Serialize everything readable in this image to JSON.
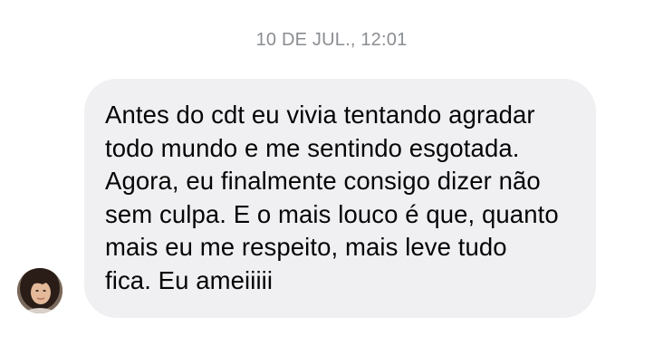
{
  "conversation": {
    "timestamp": "10 DE JUL., 12:01"
  },
  "message": {
    "text": "Antes do cdt eu vivia tentando agradar\ntodo mundo e me sentindo esgotada.\nAgora, eu finalmente consigo dizer não\nsem culpa. E o mais louco é que, quanto\nmais eu me respeito, mais leve tudo\nfica. Eu ameiiiii"
  },
  "theme": {
    "bubble_color": "#f0f0f3",
    "timestamp_color": "#8a8d91",
    "text_color": "#050505"
  },
  "icons": {
    "avatar": "sender-avatar-photo"
  }
}
